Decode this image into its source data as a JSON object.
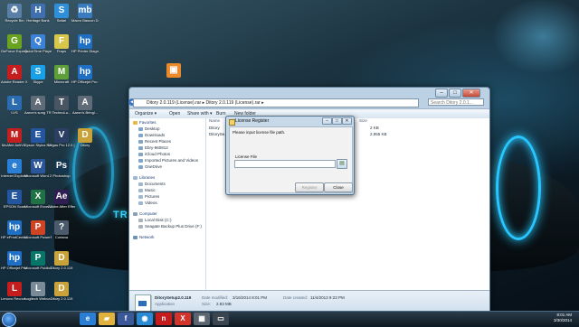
{
  "desktop": {
    "icons": [
      {
        "label": "Recycle Bin",
        "glyph": "♻",
        "color": "#5a7fa6",
        "col": 0,
        "row": 0
      },
      {
        "label": "GeForce Experience",
        "glyph": "G",
        "color": "#6aa31f",
        "col": 0,
        "row": 1
      },
      {
        "label": "Adobe Reader XI",
        "glyph": "A",
        "color": "#c51d1d",
        "col": 0,
        "row": 2
      },
      {
        "label": "LVS",
        "glyph": "L",
        "color": "#2b6cb0",
        "col": 0,
        "row": 3
      },
      {
        "label": "McAfee AntiVi...",
        "glyph": "M",
        "color": "#c21f1f",
        "col": 0,
        "row": 4
      },
      {
        "label": "Internet Explorer",
        "glyph": "e",
        "color": "#2a7fd4",
        "col": 0,
        "row": 5
      },
      {
        "label": "EPSON Scan",
        "glyph": "E",
        "color": "#2456a0",
        "col": 0,
        "row": 6
      },
      {
        "label": "HP ePrintCente...",
        "glyph": "hp",
        "color": "#1f6fc4",
        "col": 0,
        "row": 7
      },
      {
        "label": "HP Officejet Pro 8600",
        "glyph": "hp",
        "color": "#1f6fc4",
        "col": 0,
        "row": 8
      },
      {
        "label": "Lenovo Recove...",
        "glyph": "L",
        "color": "#c51d1d",
        "col": 0,
        "row": 9
      },
      {
        "label": "Heritage Bank",
        "glyph": "H",
        "color": "#3f6fae",
        "col": 1,
        "row": 0
      },
      {
        "label": "QuickTime Player",
        "glyph": "Q",
        "color": "#3c82d8",
        "col": 1,
        "row": 1
      },
      {
        "label": "Skype",
        "glyph": "S",
        "color": "#18a1e8",
        "col": 1,
        "row": 2
      },
      {
        "label": "Aaron's sung TR...",
        "glyph": "A",
        "color": "#606b78",
        "col": 1,
        "row": 3
      },
      {
        "label": "Epson Stylus NX430 User...",
        "glyph": "E",
        "color": "#2456a0",
        "col": 1,
        "row": 4
      },
      {
        "label": "Microsoft Word 2010",
        "glyph": "W",
        "color": "#2b579a",
        "col": 1,
        "row": 5
      },
      {
        "label": "Microsoft Excel 2010",
        "glyph": "X",
        "color": "#1f7244",
        "col": 1,
        "row": 6
      },
      {
        "label": "Microsoft PowerPoi...",
        "glyph": "P",
        "color": "#d04423",
        "col": 1,
        "row": 7
      },
      {
        "label": "Microsoft Publish...",
        "glyph": "P",
        "color": "#077568",
        "col": 1,
        "row": 8
      },
      {
        "label": "Logitech Webca...",
        "glyph": "L",
        "color": "#7a8a99",
        "col": 1,
        "row": 9
      },
      {
        "label": "Safari",
        "glyph": "S",
        "color": "#2f8fd8",
        "col": 2,
        "row": 0
      },
      {
        "label": "Fraps",
        "glyph": "F",
        "color": "#d6c64a",
        "col": 2,
        "row": 1
      },
      {
        "label": "Minecraft",
        "glyph": "M",
        "color": "#5f9f3a",
        "col": 2,
        "row": 2
      },
      {
        "label": "TechnoLu...",
        "glyph": "T",
        "color": "#4a5563",
        "col": 2,
        "row": 3
      },
      {
        "label": "Vegas Pro 12.0 (64-bit)",
        "glyph": "V",
        "color": "#2c3e63",
        "col": 2,
        "row": 4
      },
      {
        "label": "Photoshop",
        "glyph": "Ps",
        "color": "#14364f",
        "col": 2,
        "row": 5
      },
      {
        "label": "Adobe After Effects CC",
        "glyph": "Ae",
        "color": "#2f1e52",
        "col": 2,
        "row": 6
      },
      {
        "label": "Cortana",
        "glyph": "?",
        "color": "#4c5b6b",
        "col": 2,
        "row": 7
      },
      {
        "label": "Ditory 2.0.119",
        "glyph": "D",
        "color": "#c9a33a",
        "col": 2,
        "row": 8
      },
      {
        "label": "Ditory 2.0.119",
        "glyph": "D",
        "color": "#c9a33a",
        "col": 2,
        "row": 9
      },
      {
        "label": "Macro Bascon Del...",
        "glyph": "mb",
        "color": "#3a7bbf",
        "col": 3,
        "row": 0
      },
      {
        "label": "HP Printer Diagnost...",
        "glyph": "hp",
        "color": "#1f6fc4",
        "col": 3,
        "row": 1
      },
      {
        "label": "HP Officejet Pro 8600 F...",
        "glyph": "hp",
        "color": "#1f6fc4",
        "col": 3,
        "row": 2
      },
      {
        "label": "Aaron's Bringl...",
        "glyph": "A",
        "color": "#606b78",
        "col": 3,
        "row": 3
      },
      {
        "label": "Ditory",
        "glyph": "D",
        "color": "#c9a33a",
        "col": 3,
        "row": 4
      }
    ],
    "folder_icon": {
      "glyph": "▣",
      "color": "#e8892b"
    },
    "wallpaper_text": "TR"
  },
  "explorer": {
    "address": "Ditory 2.0.119 (License).rar  ▸  Ditory 2.0.119 (License).rar  ▸",
    "search_placeholder": "Search Ditory 2.0.1...",
    "toolbar": {
      "organize": "Organize ▾",
      "open": "Open",
      "share": "Share with ▾",
      "burn": "Burn",
      "new_folder": "New folder"
    },
    "nav": {
      "favorites_header": "Favorites",
      "favorites": [
        "Desktop",
        "Downloads",
        "Recent Places",
        "Ebry-960812",
        "iCloud Photos",
        "Imported Pictures and Videos",
        "OneDrive"
      ],
      "libraries_header": "Libraries",
      "libraries": [
        "Documents",
        "Music",
        "Pictures",
        "Videos"
      ],
      "computer_header": "Computer",
      "computer": [
        "Local Disk (C:)",
        "Seagate Backup Plus Drive (F:)"
      ],
      "network": "Network"
    },
    "columns": {
      "name": "Name",
      "size": "Size"
    },
    "files": [
      {
        "name": "Ditory",
        "size": "2 KB"
      },
      {
        "name": "DitorySe...",
        "size": "2,955 KB"
      }
    ],
    "details": {
      "filename": "DitorySetup2.0.119",
      "type": "Application",
      "modified_label": "Date modified:",
      "modified": "3/16/2014 8:01 PM",
      "created_label": "Date created:",
      "created": "11/4/2013 9:23 PM",
      "size_label": "Size:",
      "size": "2.83 MB"
    }
  },
  "dialog": {
    "title": "License Register",
    "message": "Please input license file path.",
    "field_label": "License File",
    "field_value": "",
    "register_label": "Register",
    "close_label": "Close"
  },
  "taskbar": {
    "pinned": [
      {
        "glyph": "e",
        "color": "#2a7fd4"
      },
      {
        "glyph": "▰",
        "color": "#e1b23e"
      },
      {
        "glyph": "f",
        "color": "#3b5998"
      },
      {
        "glyph": "◉",
        "color": "#2a8ad4"
      },
      {
        "glyph": "n",
        "color": "#c51d1d"
      },
      {
        "glyph": "X",
        "color": "#d2342b"
      },
      {
        "glyph": "▦",
        "color": "#5b6570"
      },
      {
        "glyph": "▭",
        "color": "#3a4550"
      }
    ],
    "time": "8:01 AM",
    "date": "3/30/2014"
  }
}
